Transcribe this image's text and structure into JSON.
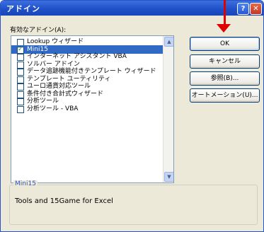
{
  "window": {
    "title": "アドイン",
    "help_btn": "?",
    "close_btn": "✕"
  },
  "list_label": "有効なアドイン(A):",
  "addins": [
    {
      "label": "Lookup ウィザード",
      "checked": false,
      "selected": false
    },
    {
      "label": "Mini15",
      "checked": true,
      "selected": true
    },
    {
      "label": "インターネット アシスタント VBA",
      "checked": false,
      "selected": false
    },
    {
      "label": "ソルバー アドイン",
      "checked": false,
      "selected": false
    },
    {
      "label": "データ追跡機能付きテンプレート ウィザード",
      "checked": false,
      "selected": false
    },
    {
      "label": "テンプレート ユーティリティ",
      "checked": false,
      "selected": false
    },
    {
      "label": "ユーロ通貨対応ツール",
      "checked": false,
      "selected": false
    },
    {
      "label": "条件付き合計式ウィザード",
      "checked": false,
      "selected": false
    },
    {
      "label": "分析ツール",
      "checked": false,
      "selected": false
    },
    {
      "label": "分析ツール - VBA",
      "checked": false,
      "selected": false
    }
  ],
  "buttons": {
    "ok": "OK",
    "cancel": "キャンセル",
    "browse": "参照(B)...",
    "automation": "オートメーション(U)..."
  },
  "description": {
    "title": "Mini15",
    "text": "Tools and 15Game for Excel"
  },
  "colors": {
    "selection": "#316ac5",
    "titlebar": "#1f4fc7",
    "arrow": "#e00000"
  }
}
